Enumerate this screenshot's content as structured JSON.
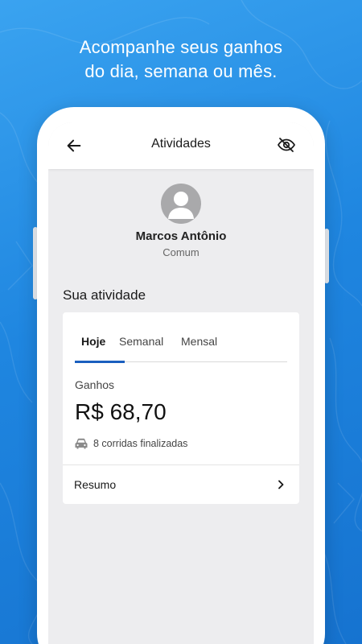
{
  "promo": {
    "headline_line1": "Acompanhe seus ganhos",
    "headline_line2": "do dia, semana ou mês."
  },
  "header": {
    "title": "Atividades",
    "back_icon": "arrow-left",
    "visibility_icon": "eye-off"
  },
  "profile": {
    "name": "Marcos Antônio",
    "tier": "Comum",
    "avatar_icon": "user-silhouette"
  },
  "activity": {
    "section_title": "Sua atividade",
    "tabs": [
      {
        "label": "Hoje",
        "active": true
      },
      {
        "label": "Semanal",
        "active": false
      },
      {
        "label": "Mensal",
        "active": false
      }
    ],
    "earnings_label": "Ganhos",
    "earnings_value": "R$ 68,70",
    "rides_icon": "car",
    "rides_text": "8 corridas finalizadas",
    "summary_label": "Resumo",
    "summary_icon": "chevron-right"
  },
  "colors": {
    "background_top": "#3aa3f0",
    "background_bottom": "#1673d0",
    "tab_indicator": "#1a5fbf",
    "screen_background": "#ededef"
  }
}
